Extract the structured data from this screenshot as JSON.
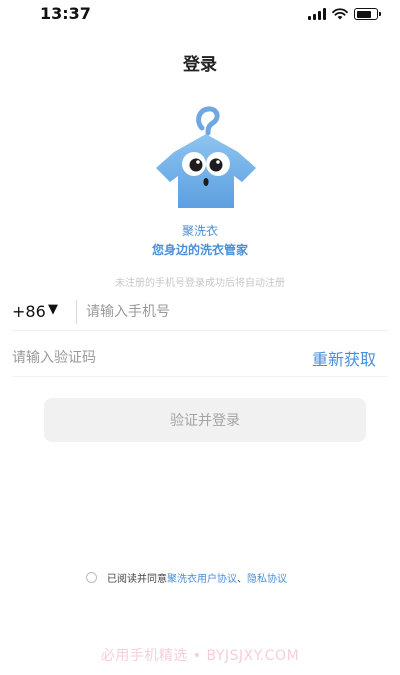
{
  "status_bar": {
    "time": "13:37"
  },
  "header": {
    "title": "登录"
  },
  "brand": {
    "logo_icon": "hanger-mascot-icon",
    "app_name": "聚洗衣",
    "slogan": "您身边的洗衣管家",
    "accent_color": "#4a8fd8"
  },
  "register_hint": "未注册的手机号登录成功后将自动注册",
  "phone_field": {
    "country_code": "+86",
    "dropdown_arrow": "▼",
    "placeholder": "请输入手机号"
  },
  "code_field": {
    "placeholder": "请输入验证码",
    "resend_label": "重新获取"
  },
  "login_button": {
    "label": "验证并登录"
  },
  "agreement": {
    "prefix": "已阅读并同意",
    "user_agreement": "聚洗衣用户协议",
    "separator": "、",
    "privacy_policy": "隐私协议"
  },
  "watermark": "必用手机精选 • BYJSJXY.COM"
}
